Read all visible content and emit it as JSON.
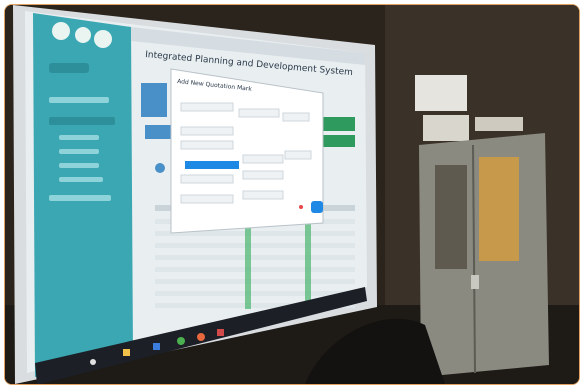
{
  "photo": {
    "kind": "photograph of a projected web application on a wall screen",
    "colors": {
      "room_wall": "#3a3128",
      "cabinet": "#8a8a80",
      "screen": "#e9eef0",
      "sidebar": "#3aa7b3",
      "accent_blue": "#1e88e5",
      "accent_green": "#2e9a5e",
      "taskbar": "#1c1f26"
    }
  },
  "app": {
    "title": "Integrated Planning and Development System",
    "modal_title": "Add New Quotation Mark"
  }
}
